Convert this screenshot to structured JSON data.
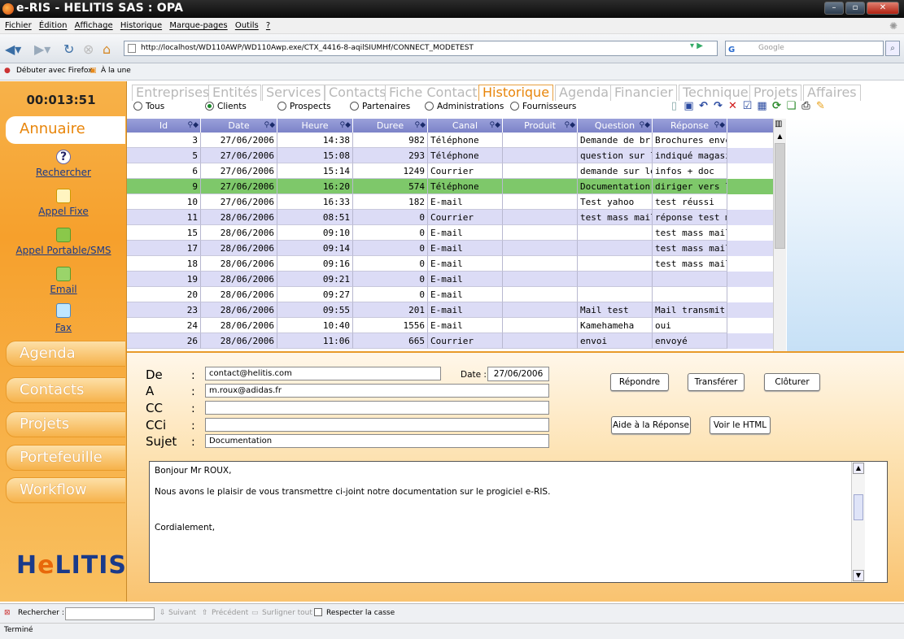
{
  "window": {
    "title": "e-RIS - HELITIS SAS : OPA"
  },
  "menu": [
    "Fichier",
    "Édition",
    "Affichage",
    "Historique",
    "Marque-pages",
    "Outils",
    "?"
  ],
  "browser": {
    "url": "http://localhost/WD110AWP/WD110Awp.exe/CTX_4416-8-aqilSIUMHf/CONNECT_MODETEST",
    "search_placeholder": "Google",
    "search_engine": "G",
    "bookmarks": [
      "Débuter avec Firefox",
      "À la une"
    ]
  },
  "sidebar": {
    "timer": "00:013:51",
    "active_section": "Annuaire",
    "links": [
      "Rechercher",
      "Appel Fixe",
      "Appel Portable/SMS",
      "Email",
      "Fax"
    ],
    "sections": [
      "Agenda",
      "Contacts",
      "Projets",
      "Portefeuille",
      "Workflow"
    ],
    "logo_prefix": "H",
    "logo_e": "e",
    "logo_suffix": "LITIS"
  },
  "tabs": [
    "Entreprises",
    "Entités",
    "Services",
    "Contacts",
    "Fiche Contact",
    "Historique",
    "Agenda",
    "Financier",
    "Technique",
    "Projets",
    "Affaires"
  ],
  "active_tab": "Historique",
  "filters": [
    "Tous",
    "Clients",
    "Prospects",
    "Partenaires",
    "Administrations",
    "Fournisseurs"
  ],
  "selected_filter": "Clients",
  "grid": {
    "columns": [
      "Id",
      "Date",
      "Heure",
      "Duree",
      "Canal",
      "Produit",
      "Question",
      "Réponse"
    ],
    "rows": [
      [
        "3",
        "27/06/2006",
        "14:38",
        "982",
        "Téléphone",
        "",
        "Demande de br",
        "Brochures envc"
      ],
      [
        "5",
        "27/06/2006",
        "15:08",
        "293",
        "Téléphone",
        "",
        "question sur la",
        "indiqué magasii"
      ],
      [
        "6",
        "27/06/2006",
        "15:14",
        "1249",
        "Courrier",
        "",
        "demande sur le",
        "infos + doc"
      ],
      [
        "9",
        "27/06/2006",
        "16:20",
        "574",
        "Téléphone",
        "",
        "Documentation",
        "diriger vers le s"
      ],
      [
        "10",
        "27/06/2006",
        "16:33",
        "182",
        "E-mail",
        "",
        "Test yahoo",
        "test réussi"
      ],
      [
        "11",
        "28/06/2006",
        "08:51",
        "0",
        "Courrier",
        "",
        "test mass maili",
        "réponse test m."
      ],
      [
        "15",
        "28/06/2006",
        "09:10",
        "0",
        "E-mail",
        "",
        "",
        "test mass mailii"
      ],
      [
        "17",
        "28/06/2006",
        "09:14",
        "0",
        "E-mail",
        "",
        "",
        "test mass mailii"
      ],
      [
        "18",
        "28/06/2006",
        "09:16",
        "0",
        "E-mail",
        "",
        "",
        "test mass mailii"
      ],
      [
        "19",
        "28/06/2006",
        "09:21",
        "0",
        "E-mail",
        "",
        "",
        ""
      ],
      [
        "20",
        "28/06/2006",
        "09:27",
        "0",
        "E-mail",
        "",
        "",
        ""
      ],
      [
        "23",
        "28/06/2006",
        "09:55",
        "201",
        "E-mail",
        "",
        "Mail test",
        "Mail transmit."
      ],
      [
        "24",
        "28/06/2006",
        "10:40",
        "1556",
        "E-mail",
        "",
        "Kamehameha",
        "oui"
      ],
      [
        "26",
        "28/06/2006",
        "11:06",
        "665",
        "Courrier",
        "",
        "envoi",
        "envoyé"
      ]
    ],
    "selected_row_id": "9"
  },
  "compose": {
    "labels": {
      "de": "De",
      "a": "A",
      "cc": "CC",
      "cci": "CCi",
      "sujet": "Sujet",
      "colon": ":",
      "date": "Date :"
    },
    "de": "contact@helitis.com",
    "a": "m.roux@adidas.fr",
    "cc": "",
    "cci": "",
    "sujet": "Documentation",
    "date": "27/06/2006",
    "buttons": {
      "repondre": "Répondre",
      "transferer": "Transférer",
      "cloturer": "Clôturer",
      "aide": "Aide à la Réponse",
      "html": "Voir le HTML"
    },
    "body": [
      "Bonjour Mr ROUX,",
      "Nous avons le plaisir de vous transmettre ci-joint notre documentation sur le progiciel e-RIS.",
      "",
      "Cordialement,"
    ]
  },
  "findbar": {
    "label": "Rechercher :",
    "next": "Suivant",
    "prev": "Précédent",
    "highlight": "Surligner tout",
    "case": "Respecter la casse"
  },
  "status": "Terminé"
}
